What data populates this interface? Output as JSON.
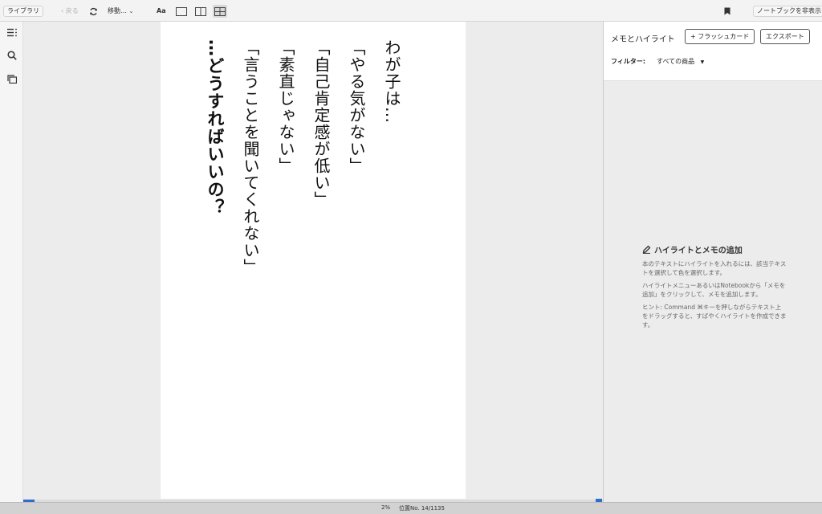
{
  "toolbar": {
    "library_label": "ライブラリ",
    "back_label": "戻る",
    "goto_label": "移動…",
    "font_label": "Aa",
    "hide_notebook_label": "ノートブックを非表示"
  },
  "book": {
    "lines": [
      "わが子は…",
      "「やる気がない」",
      "「自己肯定感が低い」",
      "「素直じゃない」",
      "「言うことを聞いてくれない」",
      "…どうすればいいの？"
    ]
  },
  "panel": {
    "title": "メモとハイライト",
    "flashcard_label": "+ フラッシュカード",
    "export_label": "エクスポート",
    "filter_label": "フィルター:",
    "filter_value": "すべての商品",
    "help_title": "ハイライトとメモの追加",
    "help_p1": "本のテキストにハイライトを入れるには、該当テキストを選択して色を選択します。",
    "help_p2": "ハイライトメニューあるいはNotebookから「メモを追加」をクリックして、メモを追加します。",
    "help_p3": "ヒント: Command ⌘キーを押しながらテキスト上をドラッグすると、すばやくハイライトを作成できます。"
  },
  "status": {
    "percent": "2%",
    "location": "位置No. 14/1135",
    "progress_fraction": 0.02
  },
  "colors": {
    "accent": "#2f6fcb"
  }
}
